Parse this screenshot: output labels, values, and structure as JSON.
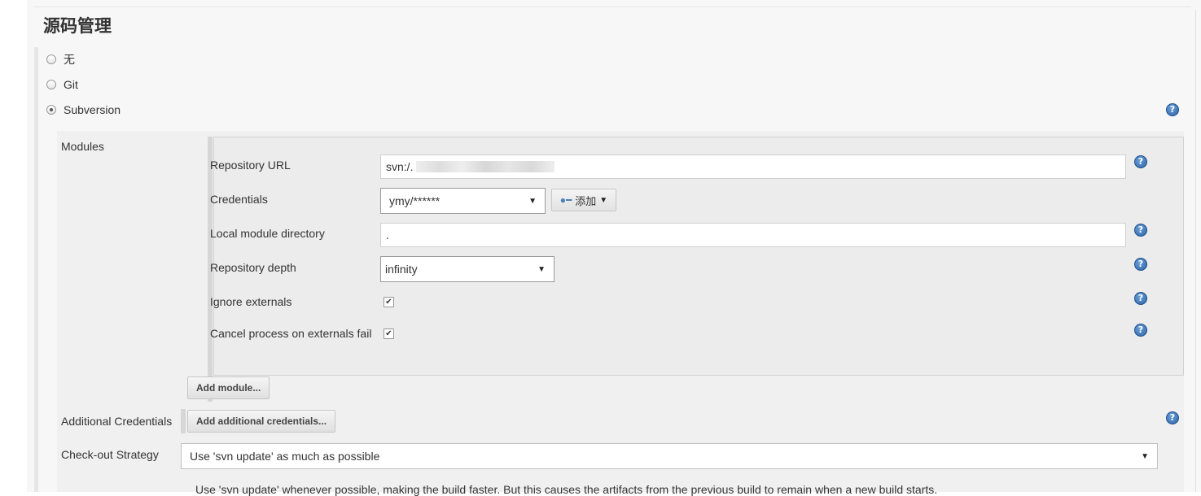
{
  "section": {
    "title": "源码管理"
  },
  "scm_options": [
    {
      "label": "无",
      "checked": false
    },
    {
      "label": "Git",
      "checked": false
    },
    {
      "label": "Subversion",
      "checked": true
    }
  ],
  "help_icon_glyph": "?",
  "modules": {
    "label": "Modules",
    "repository_url": {
      "label": "Repository URL",
      "value": "svn:/."
    },
    "credentials": {
      "label": "Credentials",
      "selected": "ymy/******",
      "add_label": "添加"
    },
    "local_module_directory": {
      "label": "Local module directory",
      "value": "."
    },
    "repository_depth": {
      "label": "Repository depth",
      "selected": "infinity"
    },
    "ignore_externals": {
      "label": "Ignore externals",
      "checked": true
    },
    "cancel_process": {
      "label": "Cancel process on externals fail",
      "checked": true
    },
    "add_module_label": "Add module..."
  },
  "additional_credentials": {
    "label": "Additional Credentials",
    "button_label": "Add additional credentials..."
  },
  "checkout_strategy": {
    "label": "Check-out Strategy",
    "selected": "Use 'svn update' as much as possible",
    "description": "Use 'svn update' whenever possible, making the build faster. But this causes the artifacts from the previous build to remain when a new build starts."
  },
  "colors": {
    "panel_bg": "#f7f7f7",
    "help_icon": "#2f64a8"
  }
}
